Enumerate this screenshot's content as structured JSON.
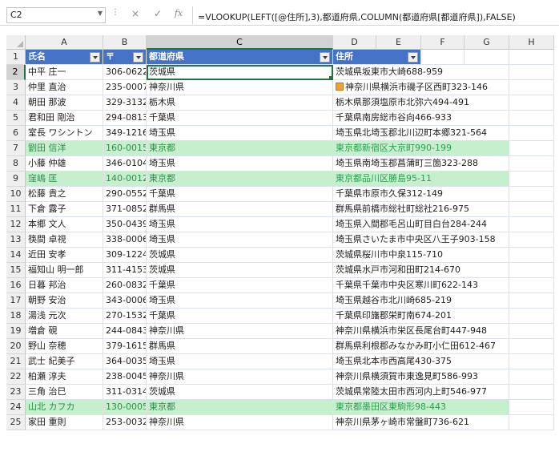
{
  "formula_bar": {
    "name_box": "C2",
    "cancel_icon": "×",
    "enter_icon": "✓",
    "fx_icon": "fx",
    "formula": "=VLOOKUP(LEFT([@住所],3),都道府県,COLUMN(都道府県[都道府県]),FALSE)"
  },
  "columns": [
    "A",
    "B",
    "C",
    "D",
    "E",
    "F",
    "G",
    "H"
  ],
  "table": {
    "headers": [
      "氏名",
      "〒",
      "都道府県",
      "住所"
    ],
    "rows": [
      {
        "n": "2",
        "name": "中平 庄一",
        "zip": "306-0622",
        "pref": "茨城県",
        "addr": "茨城県坂東市大崎688-959",
        "hl": false
      },
      {
        "n": "3",
        "name": "仲里 直治",
        "zip": "235-0007",
        "pref": "神奈川県",
        "addr": "神奈川県横浜市磯子区西町323-146",
        "hl": false
      },
      {
        "n": "4",
        "name": "朝田 那波",
        "zip": "329-3132",
        "pref": "栃木県",
        "addr": "栃木県那須塩原市北弥六494-491",
        "hl": false
      },
      {
        "n": "5",
        "name": "君和田 剛治",
        "zip": "294-0813",
        "pref": "千葉県",
        "addr": "千葉県南房総市谷向466-933",
        "hl": false
      },
      {
        "n": "6",
        "name": "室長 ワシントン",
        "zip": "349-1216",
        "pref": "埼玉県",
        "addr": "埼玉県北埼玉郡北川辺町本郷321-564",
        "hl": false
      },
      {
        "n": "7",
        "name": "劉田 信洋",
        "zip": "160-0015",
        "pref": "東京都",
        "addr": "東京都新宿区大京町990-199",
        "hl": true
      },
      {
        "n": "8",
        "name": "小藤 仲雄",
        "zip": "346-0104",
        "pref": "埼玉県",
        "addr": "埼玉県南埼玉郡菖蒲町三箇323-288",
        "hl": false
      },
      {
        "n": "9",
        "name": "窪嶋 匡",
        "zip": "140-0012",
        "pref": "東京都",
        "addr": "東京都品川区勝島95-11",
        "hl": true
      },
      {
        "n": "10",
        "name": "松藤 貴之",
        "zip": "290-0552",
        "pref": "千葉県",
        "addr": "千葉県市原市久保312-149",
        "hl": false
      },
      {
        "n": "11",
        "name": "下倉 露子",
        "zip": "371-0852",
        "pref": "群馬県",
        "addr": "群馬県前橋市総社町総社216-975",
        "hl": false
      },
      {
        "n": "12",
        "name": "本郷 文人",
        "zip": "350-0439",
        "pref": "埼玉県",
        "addr": "埼玉県入間郡毛呂山町目白台284-244",
        "hl": false
      },
      {
        "n": "13",
        "name": "筷間 卓視",
        "zip": "338-0006",
        "pref": "埼玉県",
        "addr": "埼玉県さいたま市中央区八王子903-158",
        "hl": false
      },
      {
        "n": "14",
        "name": "近田 安孝",
        "zip": "309-1224",
        "pref": "茨城県",
        "addr": "茨城県桜川市中泉115-710",
        "hl": false
      },
      {
        "n": "15",
        "name": "福知山 明一郎",
        "zip": "311-4153",
        "pref": "茨城県",
        "addr": "茨城県水戸市河和田町214-670",
        "hl": false
      },
      {
        "n": "16",
        "name": "日暮 邦治",
        "zip": "260-0832",
        "pref": "千葉県",
        "addr": "千葉県千葉市中央区寒川町622-143",
        "hl": false
      },
      {
        "n": "17",
        "name": "朝野 安治",
        "zip": "343-0006",
        "pref": "埼玉県",
        "addr": "埼玉県越谷市北川崎685-219",
        "hl": false
      },
      {
        "n": "18",
        "name": "湯浅 元次",
        "zip": "270-1532",
        "pref": "千葉県",
        "addr": "千葉県印旛郡栄町南674-201",
        "hl": false
      },
      {
        "n": "19",
        "name": "増倉 硯",
        "zip": "244-0843",
        "pref": "神奈川県",
        "addr": "神奈川県横浜市栄区長尾台町447-948",
        "hl": false
      },
      {
        "n": "20",
        "name": "野山 奈穂",
        "zip": "379-1615",
        "pref": "群馬県",
        "addr": "群馬県利根郡みなかみ町小仁田612-467",
        "hl": false
      },
      {
        "n": "21",
        "name": "武士 紀美子",
        "zip": "364-0035",
        "pref": "埼玉県",
        "addr": "埼玉県北本市西高尾430-375",
        "hl": false
      },
      {
        "n": "22",
        "name": "柏瀬 淳夫",
        "zip": "238-0045",
        "pref": "神奈川県",
        "addr": "神奈川県横須賀市東逸見町586-993",
        "hl": false
      },
      {
        "n": "23",
        "name": "三角 治巳",
        "zip": "311-0314",
        "pref": "茨城県",
        "addr": "茨城県常陸太田市西河内上町546-977",
        "hl": false
      },
      {
        "n": "24",
        "name": "山北 カフカ",
        "zip": "130-0005",
        "pref": "東京都",
        "addr": "東京都墨田区東駒形98-443",
        "hl": true
      },
      {
        "n": "25",
        "name": "家田 重則",
        "zip": "253-0032",
        "pref": "神奈川県",
        "addr": "神奈川県茅ヶ崎市常盤町736-621",
        "hl": false
      }
    ]
  }
}
